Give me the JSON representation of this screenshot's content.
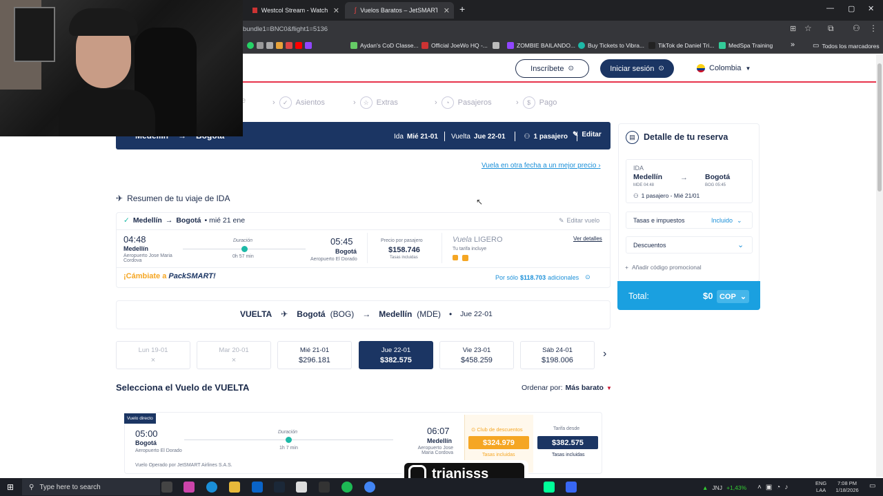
{
  "browser": {
    "tabs": [
      {
        "title": "Westcol Stream - Watch Live o",
        "active": false
      },
      {
        "title": "Vuelos Baratos – JetSMART Ai",
        "active": true
      }
    ],
    "url": "bundle1=BNC0&flight1=5136",
    "bookmarks": [
      "Aydan's CoD Classe...",
      "Official JoeWo HQ -...",
      "ZOMBIE BAILANDO...",
      "Buy Tickets to Vibra...",
      "TikTok de Daniel Tri...",
      "MedSpa Training"
    ],
    "bookmarks_more": "»",
    "all_bookmarks": "Todos los marcadores"
  },
  "header": {
    "register": "Inscríbete",
    "login": "Iniciar sesión",
    "country": "Colombia"
  },
  "steps": [
    "Asientos",
    "Extras",
    "Pasajeros",
    "Pago"
  ],
  "search_bar": {
    "ida_label": "Ida",
    "ida_date": "Mié 21-01",
    "vuelta_label": "Vuelta",
    "vuelta_date": "Jue 22-01",
    "passengers": "1 pasajero",
    "edit": "Editar",
    "origin": "Medellín",
    "destination": "Bogotá"
  },
  "better_price_link": "Vuela en otra fecha a un mejor precio",
  "ida_summary": {
    "title": "Resumen de tu viaje de IDA",
    "route_from": "Medellín",
    "route_to": "Bogotá",
    "route_date": "• mié 21 ene",
    "edit_flight": "Editar vuelo",
    "dep_time": "04:48",
    "dep_city": "Medellín",
    "dep_airport": "Aeropuerto Jose Maria Cordova",
    "duration_label": "Duración",
    "duration": "0h 57 min",
    "arr_time": "05:45",
    "arr_city": "Bogotá",
    "arr_airport": "Aeropuerto El Dorado",
    "price_label": "Precio por pasajero",
    "price": "$158.746",
    "tax_note": "Tasas incluidas",
    "fare_prefix": "Vuela",
    "fare_name": "LIGERO",
    "fare_includes": "Tu tarifa incluye",
    "details": "Ver detalles",
    "pack_prefix": "¡Cámbiate a",
    "pack_brand": "PackSMART!",
    "pack_price_prefix": "Por sólo",
    "pack_price": "$118.703",
    "pack_price_suffix": "adicionales"
  },
  "vuelta_header": {
    "label": "VUELTA",
    "from": "Bogotá",
    "from_code": "(BOG)",
    "to": "Medellín",
    "to_code": "(MDE)",
    "date": "Jue 22-01"
  },
  "date_carousel": [
    {
      "day": "Lun 19-01",
      "price": "×",
      "state": "off"
    },
    {
      "day": "Mar 20-01",
      "price": "×",
      "state": "off"
    },
    {
      "day": "Mié 21-01",
      "price": "$296.181",
      "state": "normal"
    },
    {
      "day": "Jue 22-01",
      "price": "$382.575",
      "state": "selected"
    },
    {
      "day": "Vie 23-01",
      "price": "$458.259",
      "state": "normal"
    },
    {
      "day": "Sáb 24-01",
      "price": "$198.006",
      "state": "normal"
    }
  ],
  "select_section": {
    "title": "Selecciona el Vuelo de VUELTA",
    "sort_label": "Ordenar por:",
    "sort_value": "Más barato"
  },
  "return_flight": {
    "badge": "Vuelo directo",
    "dep_time": "05:00",
    "dep_city": "Bogotá",
    "dep_airport": "Aeropuerto El Dorado",
    "duration_label": "Duración",
    "duration": "1h 7 min",
    "arr_time": "06:07",
    "arr_city": "Medellín",
    "arr_airport": "Aeropuerto Jose Maria Cordova",
    "operated": "Vuelo Operado por JetSMART Airlines S.A.S.",
    "club_label": "Club de descuentos",
    "club_price": "$324.979",
    "club_tax": "Tasas incluidas",
    "fare_label": "Tarifa desde",
    "fare_price": "$382.575",
    "fare_tax": "Tasas incluidas"
  },
  "reservation": {
    "title": "Detalle de tu reserva",
    "ida_label": "IDA",
    "from": "Medellín",
    "from_sub": "MDE 04:48",
    "to": "Bogotá",
    "to_sub": "BOG 05:45",
    "pax": "1 pasajero - Mié 21/01",
    "taxes_label": "Tasas e impuestos",
    "taxes_value": "Incluido",
    "discounts_label": "Descuentos",
    "promo": "Añadir código promocional",
    "total_label": "Total:",
    "total_value": "$0",
    "currency": "COP"
  },
  "overlay": {
    "instagram_handle": "trianisss_"
  },
  "taskbar": {
    "search": "Type here to search",
    "ticker": "JNJ",
    "ticker_change": "+1,43%",
    "lang1": "ENG",
    "lang2": "LAA",
    "time": "7:08 PM",
    "date": "1/18/2026"
  },
  "colors": {
    "navy": "#1b3563",
    "total_blue": "#1aa0e0",
    "club_orange": "#f5a623",
    "link_blue": "#1a8fd8"
  }
}
